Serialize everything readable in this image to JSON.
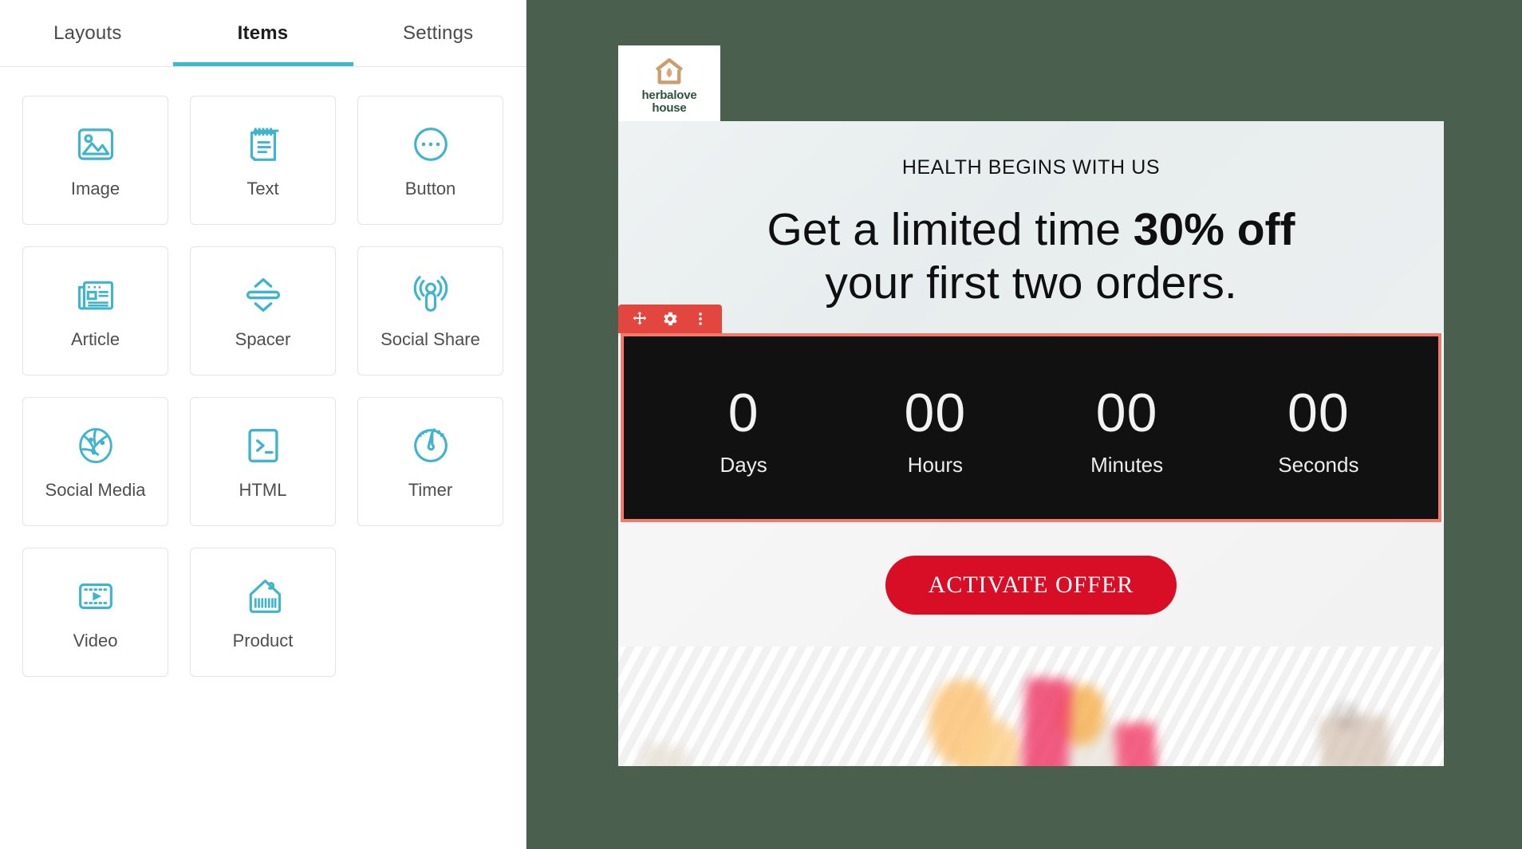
{
  "panel": {
    "tabs": [
      {
        "label": "Layouts",
        "active": false
      },
      {
        "label": "Items",
        "active": true
      },
      {
        "label": "Settings",
        "active": false
      }
    ],
    "items": [
      {
        "label": "Image",
        "icon": "image-icon"
      },
      {
        "label": "Text",
        "icon": "notepad-text-icon"
      },
      {
        "label": "Button",
        "icon": "button-circle-dots-icon"
      },
      {
        "label": "Article",
        "icon": "newspaper-icon"
      },
      {
        "label": "Spacer",
        "icon": "spacer-arrows-icon"
      },
      {
        "label": "Social Share",
        "icon": "social-share-broadcast-icon"
      },
      {
        "label": "Social Media",
        "icon": "globe-network-icon"
      },
      {
        "label": "HTML",
        "icon": "terminal-prompt-icon"
      },
      {
        "label": "Timer",
        "icon": "speedometer-timer-icon"
      },
      {
        "label": "Video",
        "icon": "film-play-icon"
      },
      {
        "label": "Product",
        "icon": "price-tag-barcode-icon"
      }
    ],
    "accent_color": "#3fb8cc"
  },
  "email": {
    "logo": {
      "line1": "herbalove",
      "line2": "house"
    },
    "eyebrow": "HEALTH BEGINS WITH US",
    "headline_part1": "Get a limited time ",
    "headline_strong": "30% off",
    "headline_part2": "your first two orders.",
    "toolbar": {
      "move_label": "move-handle",
      "settings_label": "settings",
      "more_label": "more-options"
    },
    "timer": {
      "cells": [
        {
          "value": "0",
          "label": "Days"
        },
        {
          "value": "00",
          "label": "Hours"
        },
        {
          "value": "00",
          "label": "Minutes"
        },
        {
          "value": "00",
          "label": "Seconds"
        }
      ],
      "background_color": "#111111",
      "selection_color": "#f4786b"
    },
    "cta_label": "ACTIVATE OFFER",
    "cta_color": "#d80d26",
    "header_color": "#4b5f4e"
  }
}
